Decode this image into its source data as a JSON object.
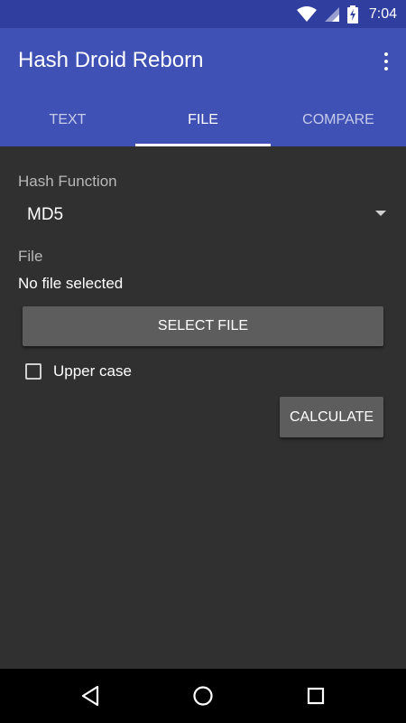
{
  "status_bar": {
    "time": "7:04",
    "icons": [
      "wifi-icon",
      "signal-icon",
      "battery-charging-icon"
    ]
  },
  "toolbar": {
    "title": "Hash Droid Reborn",
    "menu_icon": "more-vert-icon"
  },
  "tabs": [
    {
      "label": "TEXT",
      "active": false
    },
    {
      "label": "FILE",
      "active": true
    },
    {
      "label": "COMPARE",
      "active": false
    }
  ],
  "form": {
    "hash_function_label": "Hash Function",
    "hash_function_value": "MD5",
    "file_label": "File",
    "file_value": "No file selected",
    "select_file_button": "SELECT FILE",
    "uppercase_label": "Upper case",
    "uppercase_checked": false,
    "calculate_button": "CALCULATE"
  },
  "nav_bar": {
    "buttons": [
      "back-icon",
      "home-icon",
      "recents-icon"
    ]
  },
  "colors": {
    "primary": "#3f51b5",
    "primary_dark": "#303f9f",
    "background": "#303030",
    "button": "#5d5d5d"
  }
}
